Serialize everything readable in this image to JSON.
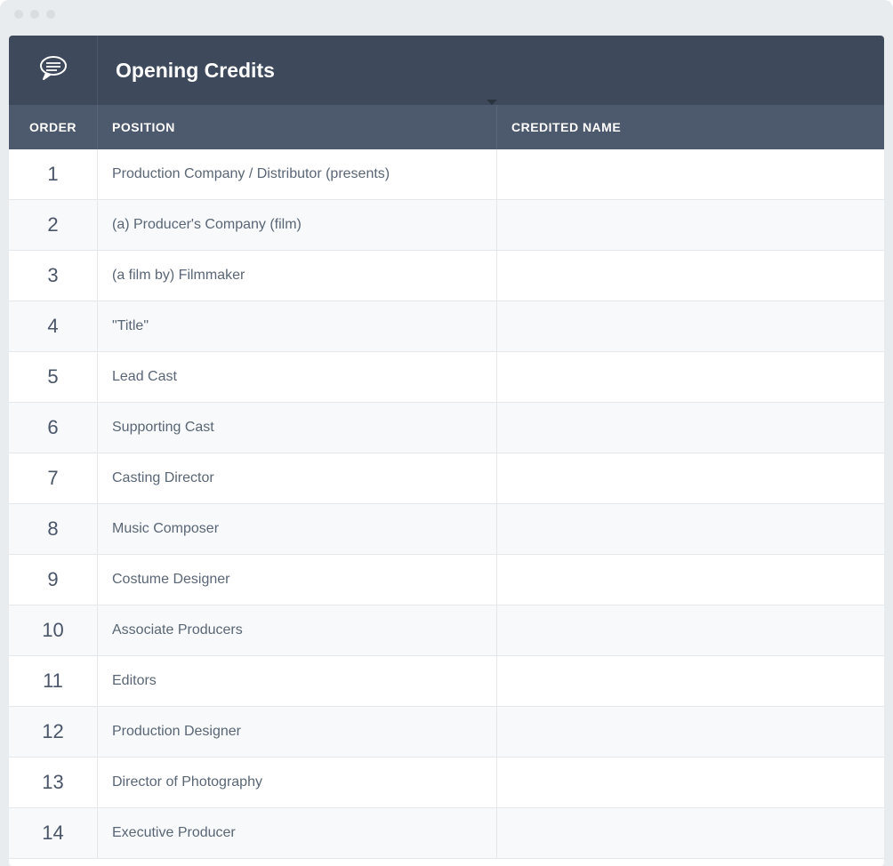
{
  "header": {
    "title": "Opening Credits"
  },
  "columns": {
    "order": "ORDER",
    "position": "POSITION",
    "credited_name": "CREDITED NAME"
  },
  "rows": [
    {
      "order": "1",
      "position": "Production Company / Distributor (presents)",
      "credited_name": ""
    },
    {
      "order": "2",
      "position": "(a) Producer's Company (film)",
      "credited_name": ""
    },
    {
      "order": "3",
      "position": "(a film by) Filmmaker",
      "credited_name": ""
    },
    {
      "order": "4",
      "position": "\"Title\"",
      "credited_name": ""
    },
    {
      "order": "5",
      "position": "Lead Cast",
      "credited_name": ""
    },
    {
      "order": "6",
      "position": "Supporting Cast",
      "credited_name": ""
    },
    {
      "order": "7",
      "position": "Casting Director",
      "credited_name": ""
    },
    {
      "order": "8",
      "position": "Music Composer",
      "credited_name": ""
    },
    {
      "order": "9",
      "position": "Costume Designer",
      "credited_name": ""
    },
    {
      "order": "10",
      "position": "Associate Producers",
      "credited_name": ""
    },
    {
      "order": "11",
      "position": "Editors",
      "credited_name": ""
    },
    {
      "order": "12",
      "position": "Production Designer",
      "credited_name": ""
    },
    {
      "order": "13",
      "position": "Director of Photography",
      "credited_name": ""
    },
    {
      "order": "14",
      "position": "Executive Producer",
      "credited_name": ""
    }
  ]
}
